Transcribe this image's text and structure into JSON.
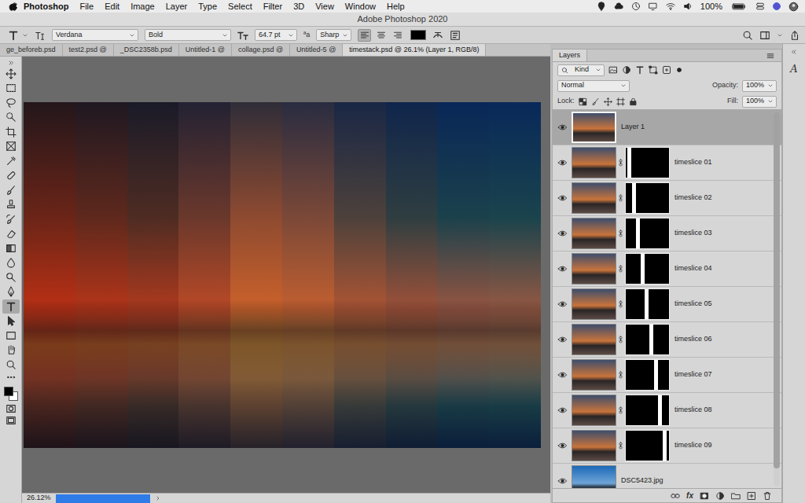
{
  "menubar": {
    "items": [
      "Photoshop",
      "File",
      "Edit",
      "Image",
      "Layer",
      "Type",
      "Select",
      "Filter",
      "3D",
      "View",
      "Window",
      "Help"
    ],
    "battery": "100%"
  },
  "window": {
    "title": "Adobe Photoshop 2020"
  },
  "options_bar": {
    "font_family": "Verdana",
    "font_style": "Bold",
    "font_size": "64.7 pt",
    "antialias_glyph": "ªa",
    "antialias": "Sharp",
    "align": [
      {
        "selected": true
      },
      {
        "selected": false
      },
      {
        "selected": false
      }
    ],
    "text_color": "#000000"
  },
  "doc_tabs": [
    {
      "label": "ge_beforeb.psd",
      "selected": false
    },
    {
      "label": "test2.psd @",
      "selected": false
    },
    {
      "label": "_DSC2358b.psd",
      "selected": false
    },
    {
      "label": "Untitled-1 @",
      "selected": false
    },
    {
      "label": "collage.psd @",
      "selected": false
    },
    {
      "label": "Untitled-5 @",
      "selected": false
    },
    {
      "label": "timestack.psd @ 26.1% (Layer 1, RGB/8)",
      "selected": true
    }
  ],
  "tools": [
    {
      "selected": false
    },
    {
      "selected": false
    },
    {
      "selected": false
    },
    {
      "selected": false
    },
    {
      "selected": false
    },
    {
      "selected": false
    },
    {
      "selected": false
    },
    {
      "selected": false
    },
    {
      "selected": false
    },
    {
      "selected": false
    },
    {
      "selected": false
    },
    {
      "selected": false
    },
    {
      "selected": false
    },
    {
      "selected": false
    },
    {
      "selected": false
    },
    {
      "selected": false
    },
    {
      "selected": true
    },
    {
      "selected": false
    },
    {
      "selected": false
    },
    {
      "selected": false
    },
    {
      "selected": false
    }
  ],
  "colors": {
    "foreground": "#000000",
    "background": "#ffffff"
  },
  "status_bar": {
    "zoom": "26.12%",
    "progress": {
      "level": 1
    }
  },
  "layers_panel": {
    "title": "Layers",
    "filter": "Kind",
    "blend_mode": "Normal",
    "opacity_label": "Opacity:",
    "opacity": "100%",
    "lock_label": "Lock:",
    "fill_label": "Fill:",
    "fill": "100%",
    "footer_fx": "fx",
    "scrollbar": {
      "level": 0.95
    },
    "layers": [
      {
        "name": "Layer 1",
        "kind": "plain",
        "visible": true,
        "selected": true
      },
      {
        "name": "timeslice 01",
        "kind": "masked",
        "visible": true,
        "selected": false
      },
      {
        "name": "timeslice 02",
        "kind": "masked",
        "visible": true,
        "selected": false
      },
      {
        "name": "timeslice 03",
        "kind": "masked",
        "visible": true,
        "selected": false
      },
      {
        "name": "timeslice 04",
        "kind": "masked",
        "visible": true,
        "selected": false
      },
      {
        "name": "timeslice 05",
        "kind": "masked",
        "visible": true,
        "selected": false
      },
      {
        "name": "timeslice 06",
        "kind": "masked",
        "visible": true,
        "selected": false
      },
      {
        "name": "timeslice 07",
        "kind": "masked",
        "visible": true,
        "selected": false
      },
      {
        "name": "timeslice 08",
        "kind": "masked",
        "visible": true,
        "selected": false
      },
      {
        "name": "timeslice 09",
        "kind": "masked",
        "visible": true,
        "selected": false
      },
      {
        "name": "DSC5423.jpg",
        "kind": "plain",
        "visible": true,
        "selected": false
      }
    ]
  },
  "side_strip": {
    "glyph": "A"
  }
}
